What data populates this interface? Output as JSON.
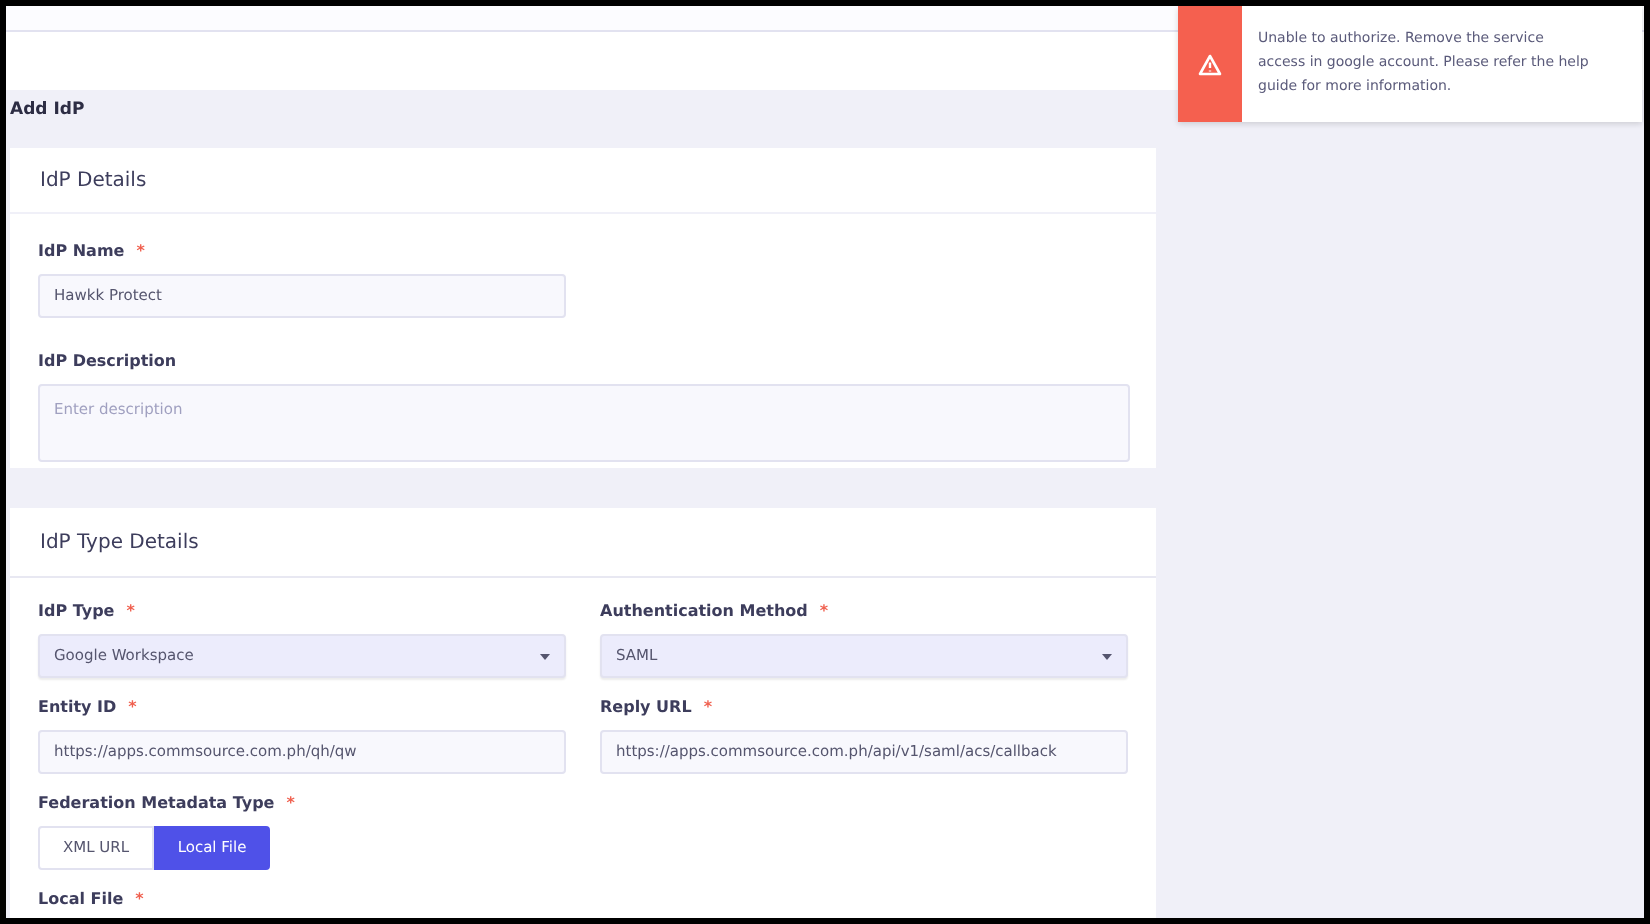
{
  "page_title": "Add IdP",
  "toast": {
    "message": "Unable to authorize. Remove the service access in google account. Please refer the help guide for more information."
  },
  "sections": [
    {
      "title": "IdP Details",
      "fields": [
        {
          "kind": "input",
          "label": "IdP Name",
          "required_mark": "*",
          "value": "Hawkk Protect",
          "half": true
        },
        {
          "kind": "textarea",
          "label": "IdP Description",
          "placeholder": "Enter description"
        }
      ]
    },
    {
      "title": "IdP Type Details",
      "fields": [
        {
          "kind": "select",
          "label": "IdP Type",
          "required_mark": "*",
          "value": "Google Workspace"
        },
        {
          "kind": "select",
          "label": "Authentication Method",
          "required_mark": "*",
          "value": "SAML"
        },
        {
          "kind": "input",
          "label": "Entity ID",
          "required_mark": "*",
          "value": "https://apps.commsource.com.ph/qh/qw"
        },
        {
          "kind": "input",
          "label": "Reply URL",
          "required_mark": "*",
          "value": "https://apps.commsource.com.ph/api/v1/saml/acs/callback"
        },
        {
          "kind": "segmented",
          "label": "Federation Metadata Type",
          "required_mark": "*",
          "options": [
            {
              "label": "XML URL",
              "selected": false
            },
            {
              "label": "Local File",
              "selected": true
            }
          ]
        },
        {
          "kind": "label",
          "label": "Local File",
          "required_mark": "*"
        }
      ]
    }
  ]
}
